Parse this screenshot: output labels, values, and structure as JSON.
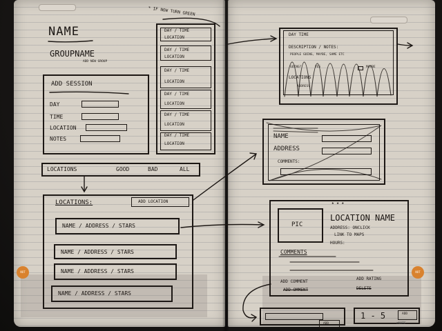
{
  "page_left_dot": "NOT",
  "page_right_dot": "NOT",
  "left_page": {
    "title": "NAME",
    "group_name": "GROUPNAME",
    "add_new_group": "ADD NEW GROUP",
    "note_top": "* IF NOW TURN GREEN",
    "add_session_panel": {
      "heading": "ADD SESSION",
      "fields": [
        "DAY",
        "TIME",
        "LOCATION",
        "NOTES"
      ]
    },
    "sessions_list": [
      "DAY / TIME",
      "LOCATION",
      "DAY / TIME",
      "LOCATION",
      "DAY / TIME",
      "LOCATION",
      "DAY / TIME",
      "LOCATION",
      "DAY / TIME",
      "LOCATION"
    ],
    "filter_tabs": [
      "LOCATIONS",
      "GOOD",
      "BAD",
      "ALL"
    ],
    "locations_panel": {
      "heading": "LOCATIONS:",
      "add_button": "ADD LOCATION",
      "rows": [
        "NAME / ADDRESS / STARS",
        "NAME / ADDRESS / STARS",
        "NAME / ADDRESS / STARS",
        "NAME / ADDRESS / STARS"
      ]
    }
  },
  "right_page": {
    "session_detail": {
      "line1": "DAY TIME",
      "line2": "DESCRIPTION / NOTES:",
      "line3": "PEOPLE GOING, MAYBE, SAME ETC",
      "line4": "GOING?",
      "opt_yes": "YES",
      "opt_maybe": "MAYBE",
      "line5": "LOCATIONS",
      "line6": "ADDRESS"
    },
    "edit_location": {
      "name_label": "NAME",
      "address_label": "ADDRESS",
      "comments_label": "COMMENTS:"
    },
    "location_detail": {
      "stars": "★ ★ ★",
      "pic": "PIC",
      "title": "LOCATION NAME",
      "address_line1": "ADDRESS: ONCLICK",
      "address_line2": "LINK TO MAPS",
      "hours": "HOURS:",
      "comments": "COMMENTS",
      "add_comment": "ADD COMMENT",
      "add_rating": "ADD RATING",
      "add_comment_sub": "ADD OMMENT",
      "add_rating_sub": "DELETE",
      "rating_scale": "1 - 5",
      "add_btn": "ADD",
      "add_btn2": "ADD",
      "brand": "©NOTE"
    }
  }
}
